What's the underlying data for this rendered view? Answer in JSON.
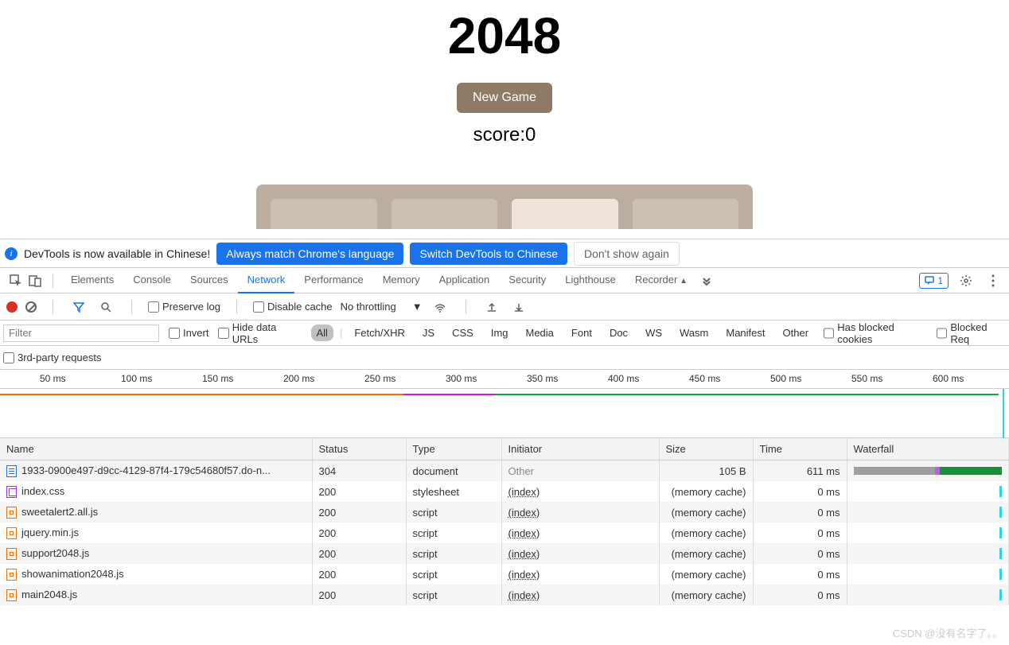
{
  "game": {
    "title": "2048",
    "new_game": "New Game",
    "score_label": "score:0"
  },
  "info_bar": {
    "text": "DevTools is now available in Chinese!",
    "btn_always": "Always match Chrome's language",
    "btn_switch": "Switch DevTools to Chinese",
    "btn_dont": "Don't show again"
  },
  "tabs": {
    "items": [
      "Elements",
      "Console",
      "Sources",
      "Network",
      "Performance",
      "Memory",
      "Application",
      "Security",
      "Lighthouse",
      "Recorder"
    ],
    "active_index": 3,
    "msg_count": "1"
  },
  "toolbar2": {
    "preserve": "Preserve log",
    "disable_cache": "Disable cache",
    "throttling": "No throttling"
  },
  "filterbar": {
    "placeholder": "Filter",
    "invert": "Invert",
    "hide_data": "Hide data URLs",
    "types": [
      "All",
      "Fetch/XHR",
      "JS",
      "CSS",
      "Img",
      "Media",
      "Font",
      "Doc",
      "WS",
      "Wasm",
      "Manifest",
      "Other"
    ],
    "blocked_cookies": "Has blocked cookies",
    "blocked_req": "Blocked Req"
  },
  "third_party": "3rd-party requests",
  "ruler": [
    "50 ms",
    "100 ms",
    "150 ms",
    "200 ms",
    "250 ms",
    "300 ms",
    "350 ms",
    "400 ms",
    "450 ms",
    "500 ms",
    "550 ms",
    "600 ms"
  ],
  "headers": {
    "name": "Name",
    "status": "Status",
    "type": "Type",
    "initiator": "Initiator",
    "size": "Size",
    "time": "Time",
    "waterfall": "Waterfall"
  },
  "rows": [
    {
      "icon": "doc",
      "name": "1933-0900e497-d9cc-4129-87f4-179c54680f57.do-n...",
      "status": "304",
      "type": "document",
      "initiator": "Other",
      "initiator_link": false,
      "size": "105 B",
      "size_cache": false,
      "time": "611 ms",
      "wf": [
        [
          "#9e9e9e",
          55
        ],
        [
          "#b366d9",
          3
        ],
        [
          "#1e8e3e",
          42
        ]
      ]
    },
    {
      "icon": "css",
      "name": "index.css",
      "status": "200",
      "type": "stylesheet",
      "initiator": "(index)",
      "initiator_link": true,
      "size": "(memory cache)",
      "size_cache": true,
      "time": "0 ms",
      "wf": []
    },
    {
      "icon": "js",
      "name": "sweetalert2.all.js",
      "status": "200",
      "type": "script",
      "initiator": "(index)",
      "initiator_link": true,
      "size": "(memory cache)",
      "size_cache": true,
      "time": "0 ms",
      "wf": []
    },
    {
      "icon": "js",
      "name": "jquery.min.js",
      "status": "200",
      "type": "script",
      "initiator": "(index)",
      "initiator_link": true,
      "size": "(memory cache)",
      "size_cache": true,
      "time": "0 ms",
      "wf": []
    },
    {
      "icon": "js",
      "name": "support2048.js",
      "status": "200",
      "type": "script",
      "initiator": "(index)",
      "initiator_link": true,
      "size": "(memory cache)",
      "size_cache": true,
      "time": "0 ms",
      "wf": []
    },
    {
      "icon": "js",
      "name": "showanimation2048.js",
      "status": "200",
      "type": "script",
      "initiator": "(index)",
      "initiator_link": true,
      "size": "(memory cache)",
      "size_cache": true,
      "time": "0 ms",
      "wf": []
    },
    {
      "icon": "js",
      "name": "main2048.js",
      "status": "200",
      "type": "script",
      "initiator": "(index)",
      "initiator_link": true,
      "size": "(memory cache)",
      "size_cache": true,
      "time": "0 ms",
      "wf": []
    }
  ],
  "watermark": "CSDN @没有名字了。。"
}
